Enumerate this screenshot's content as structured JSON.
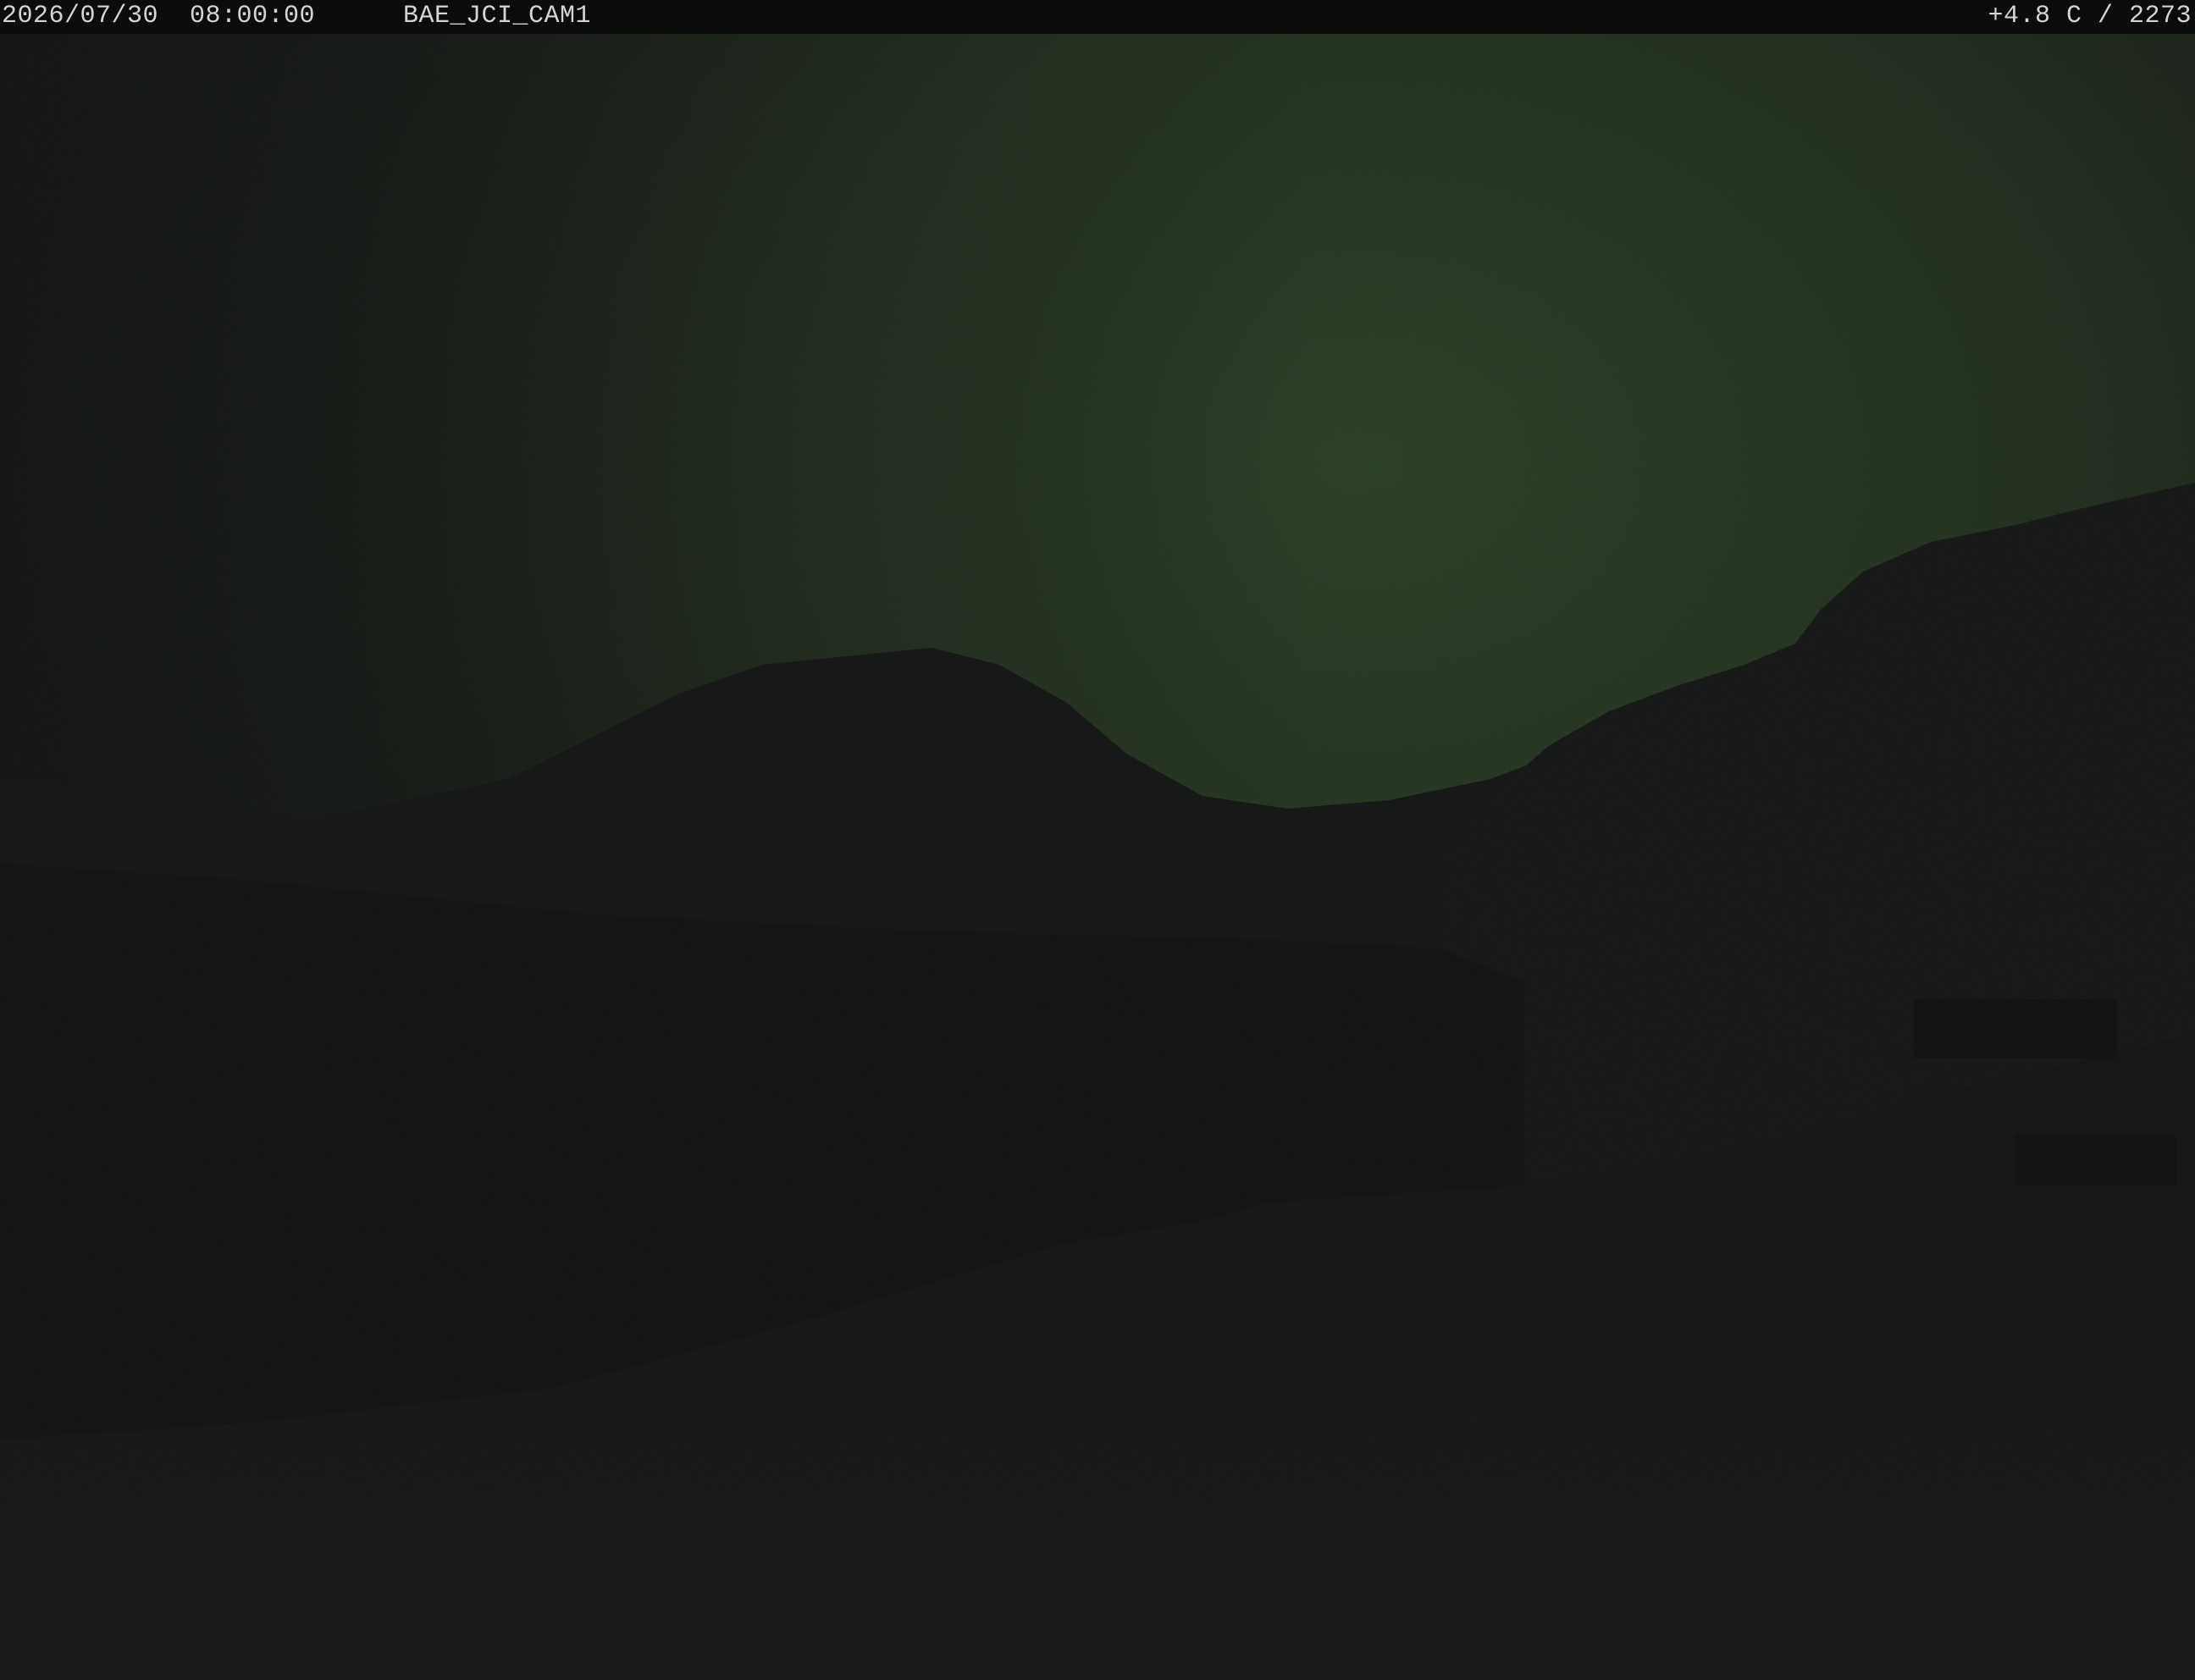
{
  "overlay": {
    "datetime": "2026/07/30  08:00:00",
    "camera_id": "BAE_JCI_CAM1",
    "readout": "+4.8 C / 2273"
  },
  "colors": {
    "sky_glow": "#2a3a26",
    "sky_dark": "#151716",
    "terrain": "#121213",
    "overlay_bg": "#0c0c0c",
    "overlay_text": "#d4d4d4"
  }
}
